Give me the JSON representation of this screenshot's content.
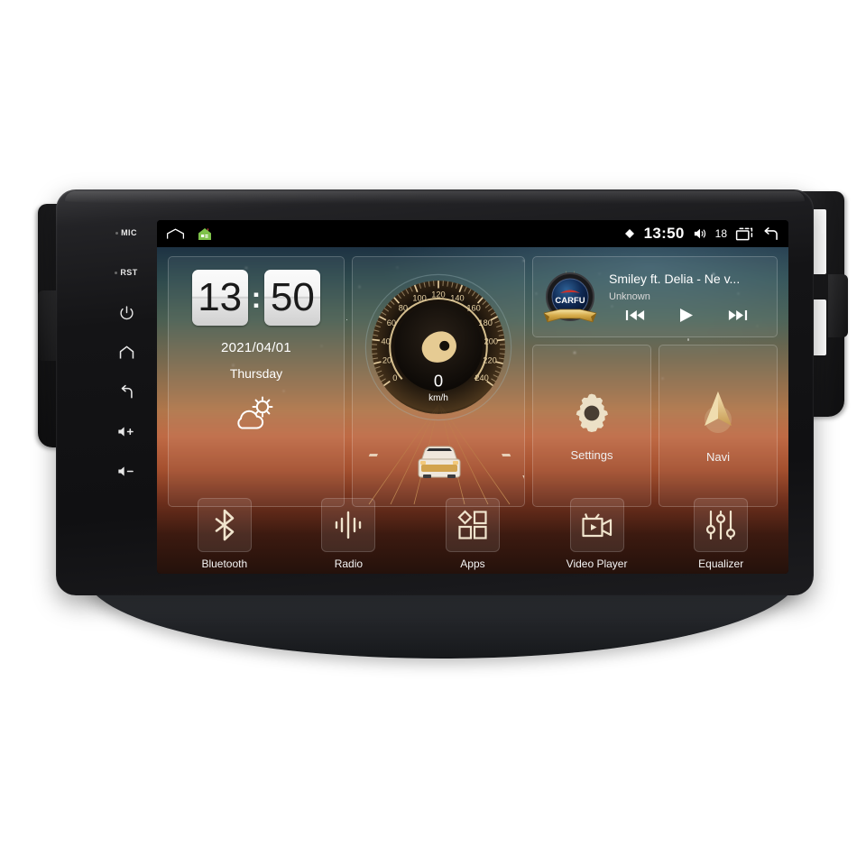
{
  "device": {
    "bezel_keys": [
      {
        "name": "mic-key",
        "label": "MIC"
      },
      {
        "name": "reset-key",
        "label": "RST"
      },
      {
        "name": "power-key",
        "label": ""
      },
      {
        "name": "home-key",
        "label": ""
      },
      {
        "name": "back-key",
        "label": ""
      },
      {
        "name": "volume-up-key",
        "label": ""
      },
      {
        "name": "volume-down-key",
        "label": ""
      }
    ]
  },
  "statusbar": {
    "home_icon": "home-outline-icon",
    "launcher_icon": "green-house-app-icon",
    "signal_icon": "signal-diamond-icon",
    "time": "13:50",
    "volume_icon": "volume-icon",
    "volume_level": "18",
    "recents_icon": "recents-icon",
    "back_icon": "back-arrow-icon"
  },
  "widgets": {
    "clock": {
      "hours": "13",
      "separator": ":",
      "minutes": "50",
      "date": "2021/04/01",
      "weekday": "Thursday",
      "weather_icon": "sun-behind-cloud-icon"
    },
    "speedometer": {
      "value": "0",
      "unit": "km/h",
      "ticks": [
        "0",
        "20",
        "40",
        "60",
        "80",
        "100",
        "120",
        "140",
        "160",
        "180",
        "200",
        "220",
        "240"
      ],
      "max": 240
    },
    "music": {
      "logo_text": "CARFU",
      "title": "Smiley ft. Delia - Ne v...",
      "artist": "Unknown",
      "prev_label": "previous-track",
      "play_label": "play",
      "next_label": "next-track"
    },
    "tiles": [
      {
        "name": "settings",
        "label": "Settings",
        "icon": "gear-icon"
      },
      {
        "name": "navi",
        "label": "Navi",
        "icon": "navigation-arrow-icon"
      }
    ]
  },
  "dock": [
    {
      "name": "bluetooth",
      "label": "Bluetooth",
      "icon": "bluetooth-icon"
    },
    {
      "name": "radio",
      "label": "Radio",
      "icon": "radio-waveform-icon"
    },
    {
      "name": "apps",
      "label": "Apps",
      "icon": "apps-grid-icon"
    },
    {
      "name": "video-player",
      "label": "Video Player",
      "icon": "video-camera-icon"
    },
    {
      "name": "equalizer",
      "label": "Equalizer",
      "icon": "equalizer-sliders-icon"
    }
  ],
  "colors": {
    "accent_gold": "#e8cf9a",
    "screen_black": "#000000",
    "bezel_black": "#141416",
    "text_white": "#ffffff"
  }
}
